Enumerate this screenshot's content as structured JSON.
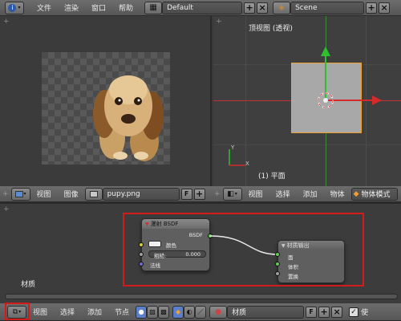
{
  "top_bar": {
    "menus": [
      "文件",
      "渲染",
      "窗口",
      "帮助"
    ],
    "layout_name": "Default",
    "scene_name": "Scene"
  },
  "image_editor": {
    "menus": [
      "视图",
      "图像"
    ],
    "image_name": "pupy.png",
    "fake_user": "F"
  },
  "viewport_3d": {
    "view_label": "顶视图 (透视)",
    "object_label": "(1) 平面",
    "axis_y": "Y",
    "axis_x": "X",
    "menus": [
      "视图",
      "选择",
      "添加",
      "物体"
    ],
    "mode": "物体模式"
  },
  "node_editor": {
    "material_label": "材质",
    "menus": [
      "视图",
      "选择",
      "添加",
      "节点"
    ],
    "material_name": "材质",
    "fake_user": "F",
    "use_label": "使",
    "bsdf_node": {
      "title": "漫射 BSDF",
      "output": "BSDF",
      "input_color": "颜色",
      "roughness_label": "粗糙:",
      "roughness_value": "0.000",
      "input_normal": "法线"
    },
    "output_node": {
      "title": "材质输出",
      "inputs": [
        "面",
        "体积",
        "置换"
      ]
    }
  },
  "colors": {
    "highlight_red": "#d41b1b",
    "axis_green": "#2ec12e",
    "axis_red": "#d42a2a",
    "selection_orange": "#f0a030",
    "socket_green": "#5fd14f",
    "socket_yellow": "#d8cf38",
    "socket_gray": "#a0a0a0",
    "socket_purple": "#6a6ad8"
  },
  "icons": [
    "info-icon",
    "layout-icon",
    "scene-icon",
    "image-icon",
    "cube-icon",
    "node-tree-icon",
    "sphere-icon"
  ]
}
